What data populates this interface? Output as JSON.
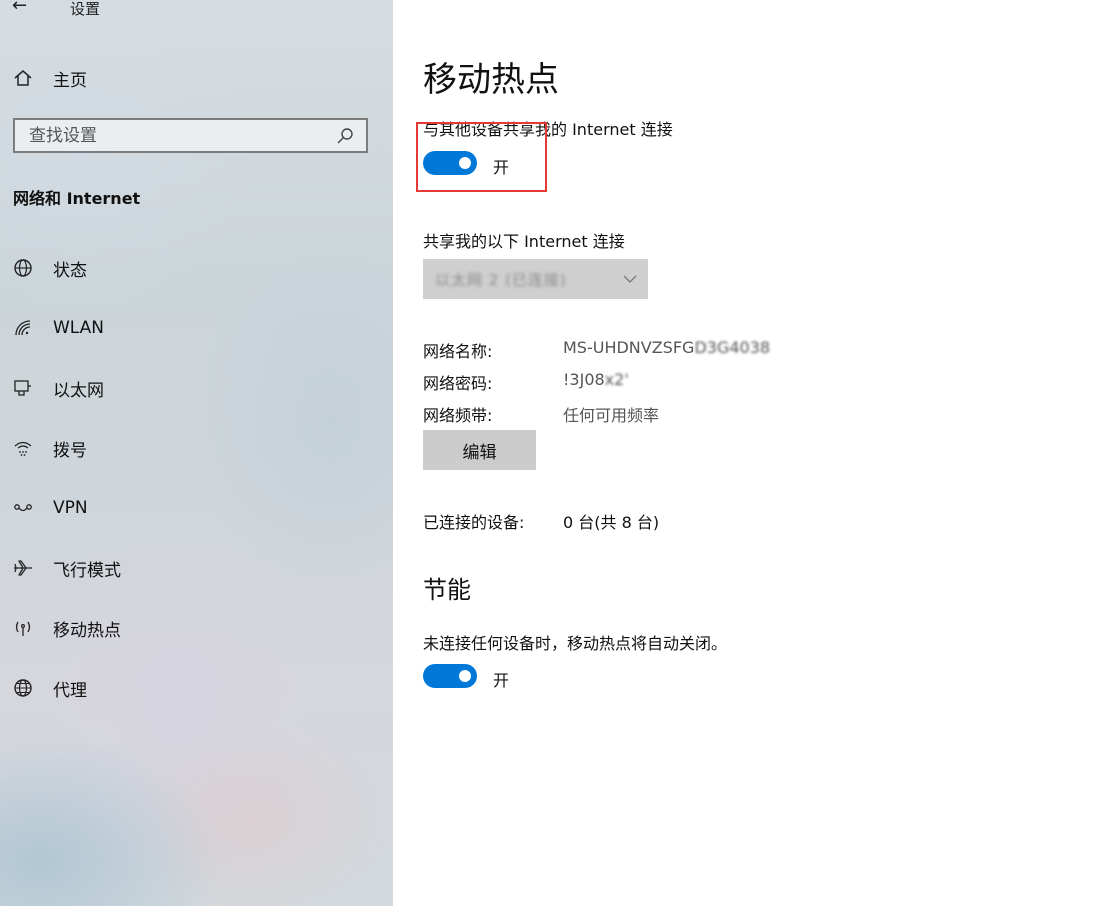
{
  "window": {
    "title": "设置",
    "back_icon": "back-arrow-icon"
  },
  "sidebar": {
    "home_label": "主页",
    "search_placeholder": "查找设置",
    "section_title": "网络和 Internet",
    "items": [
      {
        "label": "状态",
        "icon": "globe-status-icon"
      },
      {
        "label": "WLAN",
        "icon": "wifi-icon"
      },
      {
        "label": "以太网",
        "icon": "ethernet-icon"
      },
      {
        "label": "拨号",
        "icon": "dialup-icon"
      },
      {
        "label": "VPN",
        "icon": "vpn-icon"
      },
      {
        "label": "飞行模式",
        "icon": "airplane-icon"
      },
      {
        "label": "移动热点",
        "icon": "hotspot-icon"
      },
      {
        "label": "代理",
        "icon": "globe-icon"
      }
    ]
  },
  "main": {
    "title": "移动热点",
    "share_label": "与其他设备共享我的 Internet 连接",
    "share_toggle": {
      "state": "开",
      "on": true
    },
    "connection_label": "共享我的以下 Internet 连接",
    "connection_value": "以太网 2 (已连接)",
    "network_name_label": "网络名称:",
    "network_name_value": "MS-UHDNVZSFG",
    "network_name_tail": "D3G4038",
    "network_password_label": "网络密码:",
    "network_password_value": "!3J08",
    "network_password_tail": "x2'",
    "network_band_label": "网络频带:",
    "network_band_value": "任何可用频率",
    "edit_button": "编辑",
    "connected_devices_label": "已连接的设备:",
    "connected_devices_value": "0 台(共 8 台)",
    "power_saving": {
      "heading": "节能",
      "description": "未连接任何设备时，移动热点将自动关闭。",
      "toggle_state": "开",
      "on": true
    }
  },
  "colors": {
    "accent": "#0078d7",
    "highlight": "#e53935"
  }
}
